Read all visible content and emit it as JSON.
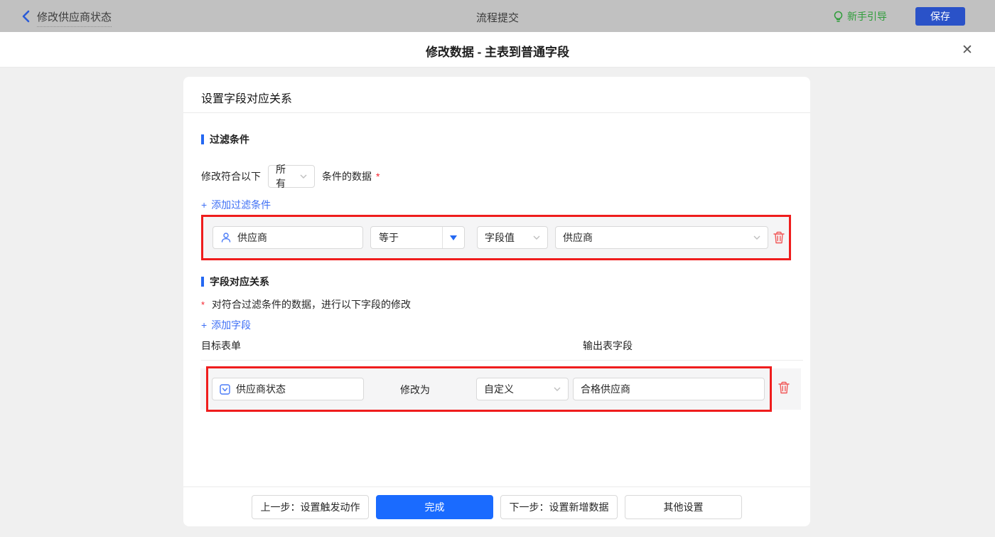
{
  "topbar": {
    "flow_name": "修改供应商状态",
    "center_title": "流程提交",
    "guide_label": "新手引导",
    "save_label": "保存"
  },
  "modal": {
    "title": "修改数据 - 主表到普通字段",
    "close_glyph": "✕"
  },
  "panel": {
    "header": "设置字段对应关系"
  },
  "filter_section": {
    "title": "过滤条件",
    "sentence_prefix": "修改符合以下",
    "match_select_value": "所有",
    "sentence_suffix": "条件的数据",
    "required_mark": "*",
    "add_label": "添加过滤条件",
    "row": {
      "field": "供应商",
      "operator": "等于",
      "value_type": "字段值",
      "value": "供应商"
    }
  },
  "mapping_section": {
    "title": "字段对应关系",
    "required_mark": "*",
    "note": "对符合过滤条件的数据，进行以下字段的修改",
    "add_label": "添加字段",
    "col_target": "目标表单",
    "col_output": "输出表字段",
    "row": {
      "field": "供应商状态",
      "modify_label": "修改为",
      "mode": "自定义",
      "value": "合格供应商"
    }
  },
  "footer": {
    "prev_label": "上一步：设置触发动作",
    "done_label": "完成",
    "next_label": "下一步：设置新增数据",
    "other_label": "其他设置"
  },
  "icons": {
    "plus": "+"
  },
  "colors": {
    "accent_blue": "#1a6bff",
    "link_blue": "#3e6ff5",
    "annotation_red": "#ef1d1d",
    "danger_red": "#f15757",
    "guide_green": "#2f9d3a"
  }
}
